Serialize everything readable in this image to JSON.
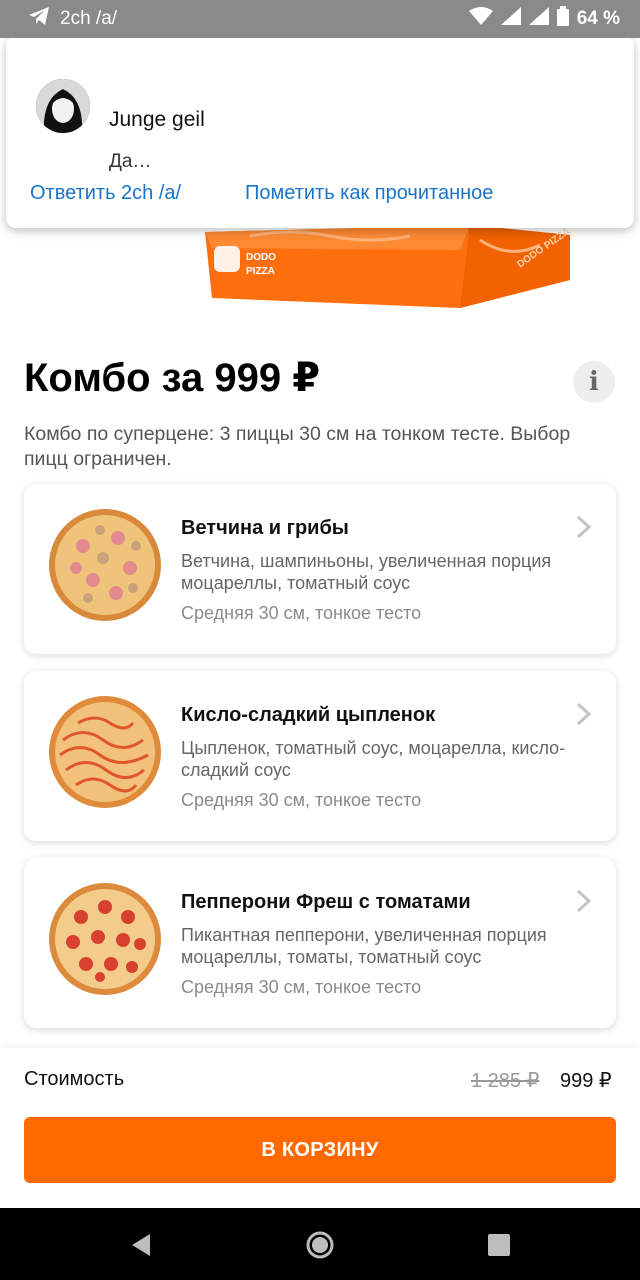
{
  "status_bar": {
    "app_text": "2ch /a/",
    "battery": "64 %"
  },
  "hero": {
    "brand_line1": "DODO",
    "brand_line2": "PIZZA",
    "side_text": "DODO PIZZA"
  },
  "notification": {
    "title": "Junge geil",
    "text": "Да…",
    "actions": [
      "Ответить 2ch /a/",
      "Пометить как прочитанное"
    ]
  },
  "combo": {
    "title": "Комбо за 999 ₽",
    "info_glyph": "i",
    "description": "Комбо по суперцене: 3 пиццы 30 см на тонком тесте. Выбор пицц ограничен."
  },
  "pizzas": [
    {
      "name": "Ветчина и грибы",
      "ingredients": "Ветчина, шампиньоны, увеличенная порция моцареллы, томатный соус",
      "size": "Средняя 30 см, тонкое тесто"
    },
    {
      "name": "Кисло-сладкий цыпленок",
      "ingredients": "Цыпленок, томатный соус, моцарелла, кисло-сладкий соус",
      "size": "Средняя 30 см, тонкое тесто"
    },
    {
      "name": "Пепперони Фреш с томатами",
      "ingredients": "Пикантная пепперони, увеличенная порция моцареллы, томаты, томатный соус",
      "size": "Средняя 30 см, тонкое тесто"
    }
  ],
  "footer": {
    "cost_label": "Стоимость",
    "old_price": "1 285 ₽",
    "new_price": "999 ₽",
    "cart_button": "В КОРЗИНУ"
  },
  "colors": {
    "accent": "#ff6900",
    "link": "#1b74c8",
    "status_bar": "#8a8a8a"
  },
  "icons": [
    "telegram-icon",
    "wifi-icon",
    "signal-icon",
    "battery-icon",
    "info-icon",
    "chevron-right-icon",
    "back-icon",
    "home-icon",
    "recents-icon"
  ]
}
